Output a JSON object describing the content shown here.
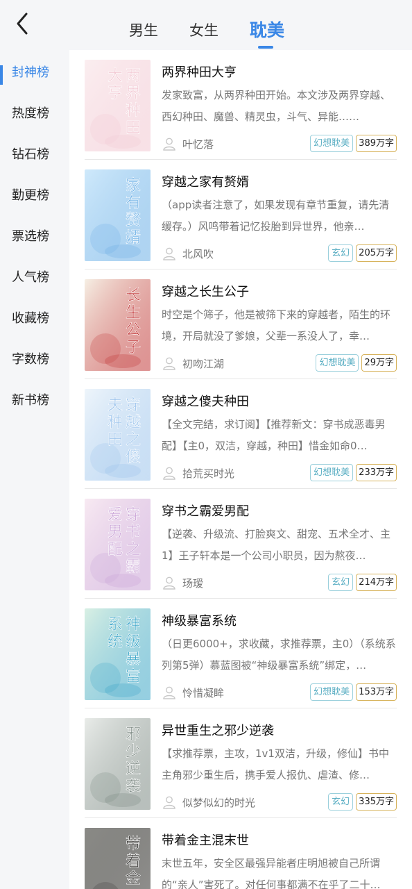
{
  "header": {
    "back_icon": "chevron-left-icon",
    "tabs": [
      {
        "label": "男生"
      },
      {
        "label": "女生"
      },
      {
        "label": "耽美"
      }
    ],
    "active_tab": 2,
    "accent": "#3a87e6"
  },
  "sidebar": {
    "items": [
      {
        "label": "封神榜"
      },
      {
        "label": "热度榜"
      },
      {
        "label": "钻石榜"
      },
      {
        "label": "勤更榜"
      },
      {
        "label": "票选榜"
      },
      {
        "label": "人气榜"
      },
      {
        "label": "收藏榜"
      },
      {
        "label": "字数榜"
      },
      {
        "label": "新书榜"
      }
    ],
    "active_index": 0
  },
  "books": [
    {
      "title": "两界种田大亨",
      "desc": "发家致富，从两界种田开始。本文涉及两界穿越、西幻种田、魔兽、精灵虫，斗气、异能……",
      "author": "叶忆落",
      "genre": "幻想耽美",
      "words": "389万字",
      "cover_text": "两界种田大亨",
      "cover_colors": [
        "#fbeef0",
        "#f2c9d3"
      ]
    },
    {
      "title": "穿越之家有赘婿",
      "desc": "（app读者注意了，如果发现有章节重复，请先清缓存。）风鸣带着记忆投胎到异世界，他亲…",
      "author": "北风吹",
      "genre": "玄幻",
      "words": "205万字",
      "cover_text": "家有赘婿",
      "cover_colors": [
        "#cfe9fb",
        "#6fb1e6"
      ]
    },
    {
      "title": "穿越之长生公子",
      "desc": "时空是个筛子，他是被筛下来的穿越者，陌生的环境，开局就没了爹娘，父辈一系没人了，幸…",
      "author": "初吻江湖",
      "genre": "幻想耽美",
      "words": "29万字",
      "cover_text": "长生公子",
      "cover_colors": [
        "#f6efe4",
        "#c23b3b"
      ]
    },
    {
      "title": "穿越之傻夫种田",
      "desc": "【全文完结，求订阅】【推荐新文：穿书成恶毒男配】【主0，双洁，穿越，种田】惜金如命0…",
      "author": "拾荒买时光",
      "genre": "幻想耽美",
      "words": "233万字",
      "cover_text": "穿越之傻夫种田",
      "cover_colors": [
        "#eef5fb",
        "#9cc4ec"
      ]
    },
    {
      "title": "穿书之霸爱男配",
      "desc": "【逆袭、升级流、打脸爽文、甜宠、五术全才、主1】王子轩本是一个公司小职员，因为熬夜…",
      "author": "玚瑷",
      "genre": "玄幻",
      "words": "214万字",
      "cover_text": "穿书之霸爱男配",
      "cover_colors": [
        "#f8eaf2",
        "#c9a2d6"
      ]
    },
    {
      "title": "神级暴富系统",
      "desc": "（日更6000+，求收藏，求推荐票，主0）（系统系列第5弹）慕蓝图被“神级暴富系统”绑定，…",
      "author": "怜惜凝眸",
      "genre": "幻想耽美",
      "words": "153万字",
      "cover_text": "神级暴富系统",
      "cover_colors": [
        "#d9f0e4",
        "#3fa7c9"
      ]
    },
    {
      "title": "异世重生之邪少逆袭",
      "desc": "【求推荐票，主攻，1v1双洁，升级，修仙】书中主角邪少重生后，携手爱人报仇、虐渣、修…",
      "author": "似梦似幻的时光",
      "genre": "玄幻",
      "words": "335万字",
      "cover_text": "邪少逆袭",
      "cover_colors": [
        "#e9ece9",
        "#7d8a84"
      ]
    },
    {
      "title": "带着金主混末世",
      "desc": "末世五年，安全区最强异能者庄明旭被自己所谓的“亲人”害死了。对任何事都满不在乎了二十…",
      "author": "",
      "genre": "",
      "words": "",
      "cover_text": "带着金",
      "cover_colors": [
        "#8a8a86",
        "#3e3d3a"
      ]
    }
  ]
}
